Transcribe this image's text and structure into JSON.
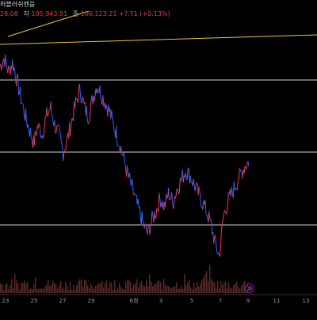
{
  "header": {
    "symbol_fragment": "허블러쉬멘움"
  },
  "ohlc": {
    "open_value": "28,08",
    "high_label": "저",
    "high_value": "105,943.91",
    "low_label": "종",
    "low_value": "106,123.21",
    "change_value": "+?.71 (+0.13%)"
  },
  "colors": {
    "background": "#000000",
    "up": "#f23645",
    "down": "#2962ff",
    "trendline": "#f0c040",
    "hline": "#d1d4dc",
    "volume": "#5d2a2a"
  },
  "time_axis": {
    "labels": [
      "23",
      "25",
      "27",
      "29",
      "6월",
      "3",
      "5",
      "7",
      "9",
      "11",
      "13"
    ]
  },
  "chart_data": {
    "type": "candlestick",
    "title": "",
    "xlabel": "",
    "ylabel": "",
    "x_labels": [
      "23",
      "25",
      "27",
      "29",
      "6월",
      "3",
      "5",
      "7",
      "9",
      "11",
      "13"
    ],
    "horizontal_levels": [
      "upper",
      "mid",
      "lower"
    ],
    "price_path_relative": [
      0.88,
      0.92,
      0.86,
      0.9,
      0.82,
      0.74,
      0.66,
      0.6,
      0.54,
      0.62,
      0.58,
      0.66,
      0.7,
      0.62,
      0.58,
      0.5,
      0.56,
      0.64,
      0.72,
      0.78,
      0.7,
      0.66,
      0.74,
      0.8,
      0.76,
      0.72,
      0.68,
      0.62,
      0.56,
      0.5,
      0.42,
      0.36,
      0.3,
      0.24,
      0.18,
      0.14,
      0.2,
      0.24,
      0.3,
      0.26,
      0.32,
      0.28,
      0.34,
      0.38,
      0.42,
      0.4,
      0.36,
      0.32,
      0.28,
      0.24,
      0.18,
      0.1,
      0.04,
      0.22,
      0.28,
      0.32,
      0.36,
      0.4,
      0.44,
      0.46
    ]
  },
  "buttons": {
    "go_to_realtime": "go-to-realtime"
  }
}
